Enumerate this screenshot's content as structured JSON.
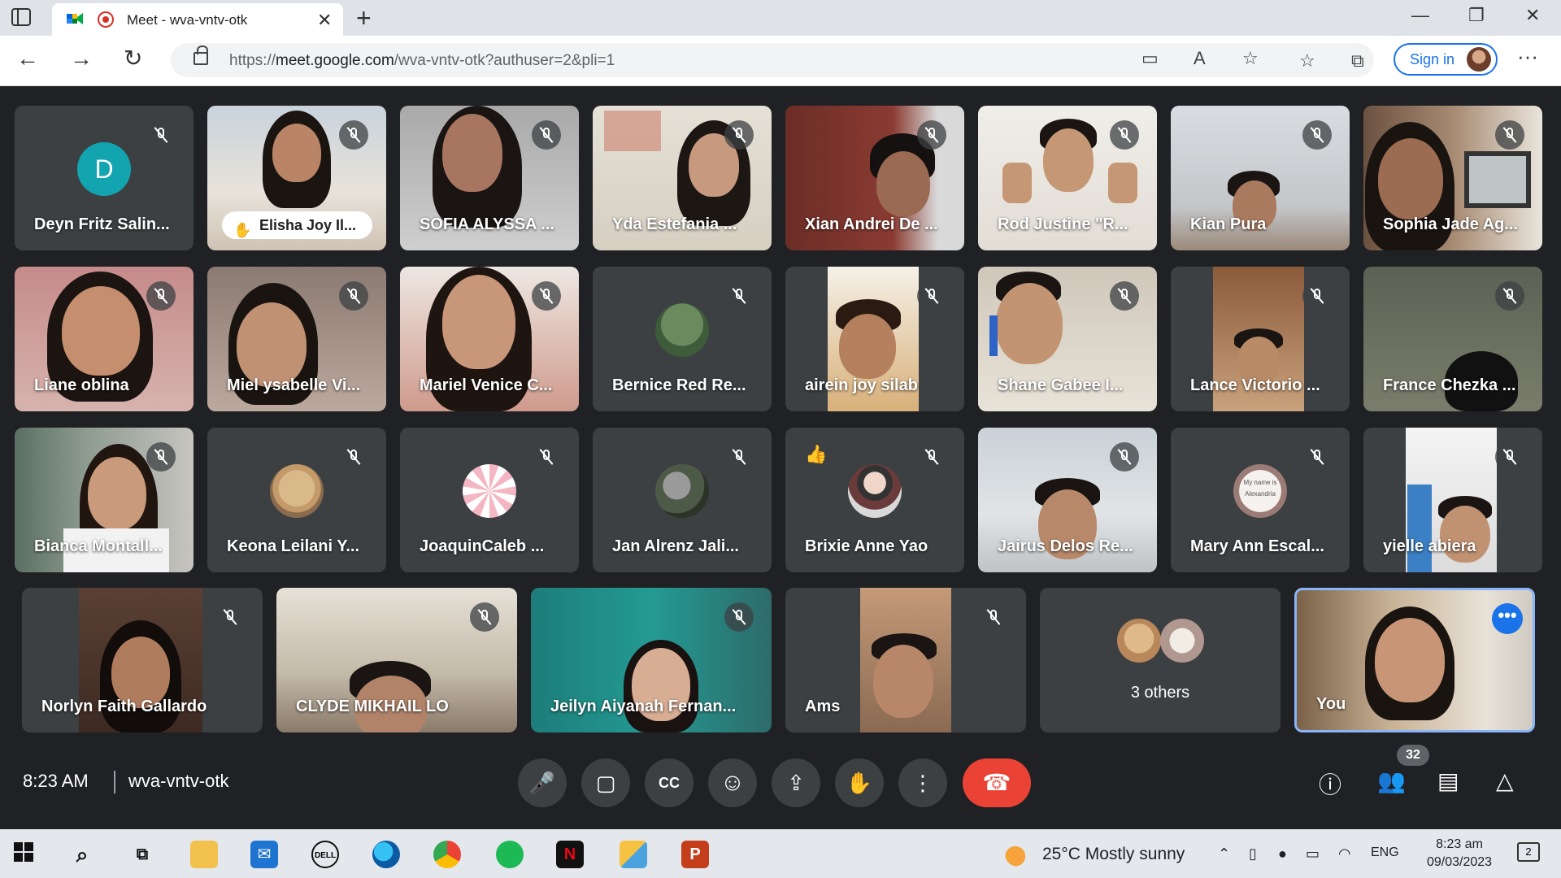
{
  "browser": {
    "tab_title": "Meet - wva-vntv-otk",
    "tab_close": "✕",
    "new_tab": "+",
    "url_prefix": "https://",
    "url_host": "meet.google.com",
    "url_path": "/wva-vntv-otk?authuser=2&pli=1",
    "sign_in": "Sign in",
    "window_controls": [
      "—",
      "❐",
      "✕"
    ],
    "nav_back": "←",
    "nav_forward": "→",
    "nav_reload": "↻",
    "more": "···",
    "addr_icons": {
      "camera": "▭",
      "read_aloud": "A",
      "add_favorite": "☆",
      "favorites": "☆",
      "collections": "⧉"
    }
  },
  "participants": [
    {
      "name": "Deyn Fritz Salin...",
      "type": "avatar",
      "initial": "D",
      "color": "#12a4af"
    },
    {
      "name": "Elisha Joy Il...",
      "type": "video",
      "raised_hand": true
    },
    {
      "name": "SOFIA ALYSSA ...",
      "type": "video"
    },
    {
      "name": "Yda Estefania ...",
      "type": "video"
    },
    {
      "name": "Xian Andrei De ...",
      "type": "video"
    },
    {
      "name": "Rod Justine \"R...",
      "type": "video"
    },
    {
      "name": "Kian Pura",
      "type": "video"
    },
    {
      "name": "Sophia Jade Ag...",
      "type": "video"
    },
    {
      "name": "Liane oblina",
      "type": "video"
    },
    {
      "name": "Miel ysabelle Vi...",
      "type": "video"
    },
    {
      "name": "Mariel Venice C...",
      "type": "video"
    },
    {
      "name": "Bernice Red Re...",
      "type": "avatar"
    },
    {
      "name": "airein joy silab",
      "type": "video"
    },
    {
      "name": "Shane Gabee I...",
      "type": "video"
    },
    {
      "name": "Lance Victorio ...",
      "type": "video"
    },
    {
      "name": "France Chezka ...",
      "type": "video"
    },
    {
      "name": "Bianca Montall...",
      "type": "video"
    },
    {
      "name": "Keona Leilani Y...",
      "type": "avatar"
    },
    {
      "name": "JoaquinCaleb ...",
      "type": "avatar"
    },
    {
      "name": "Jan Alrenz Jali...",
      "type": "avatar"
    },
    {
      "name": "Brixie Anne Yao",
      "type": "avatar",
      "reaction": "👍"
    },
    {
      "name": "Jairus Delos Re...",
      "type": "video"
    },
    {
      "name": "Mary Ann Escal...",
      "type": "avatar",
      "avatar_text": "My name is Alexandria"
    },
    {
      "name": "yielle abiera",
      "type": "video"
    },
    {
      "name": "Norlyn Faith Gallardo",
      "type": "video"
    },
    {
      "name": "CLYDE MIKHAIL LO",
      "type": "video"
    },
    {
      "name": "Jeilyn Aiyanah Fernan...",
      "type": "video"
    },
    {
      "name": "Ams",
      "type": "video"
    }
  ],
  "others_label": "3 others",
  "self_label": "You",
  "self_more": "•••",
  "bottom": {
    "time": "8:23 AM",
    "meeting_code": "wva-vntv-otk",
    "participant_count": "32",
    "controls": [
      "mic",
      "camera",
      "captions",
      "emoji",
      "present",
      "raise-hand",
      "more"
    ]
  },
  "icons": {
    "mic": "🎤",
    "camera": "▢",
    "captions": "CC",
    "emoji": "☺",
    "present": "⇪",
    "hand": "✋",
    "more": "⋮",
    "hangup": "☎",
    "info": "ⓘ",
    "people": "👥",
    "chat": "▤",
    "activities": "△"
  },
  "taskbar": {
    "apps": [
      "start",
      "search",
      "task-view",
      "file-explorer",
      "mail",
      "dell",
      "edge",
      "chrome",
      "spotify",
      "netflix",
      "files",
      "powerpoint"
    ],
    "weather": "25°C  Mostly sunny",
    "lang": "ENG",
    "time": "8:23 am",
    "date": "09/03/2023",
    "notifications": "2"
  }
}
